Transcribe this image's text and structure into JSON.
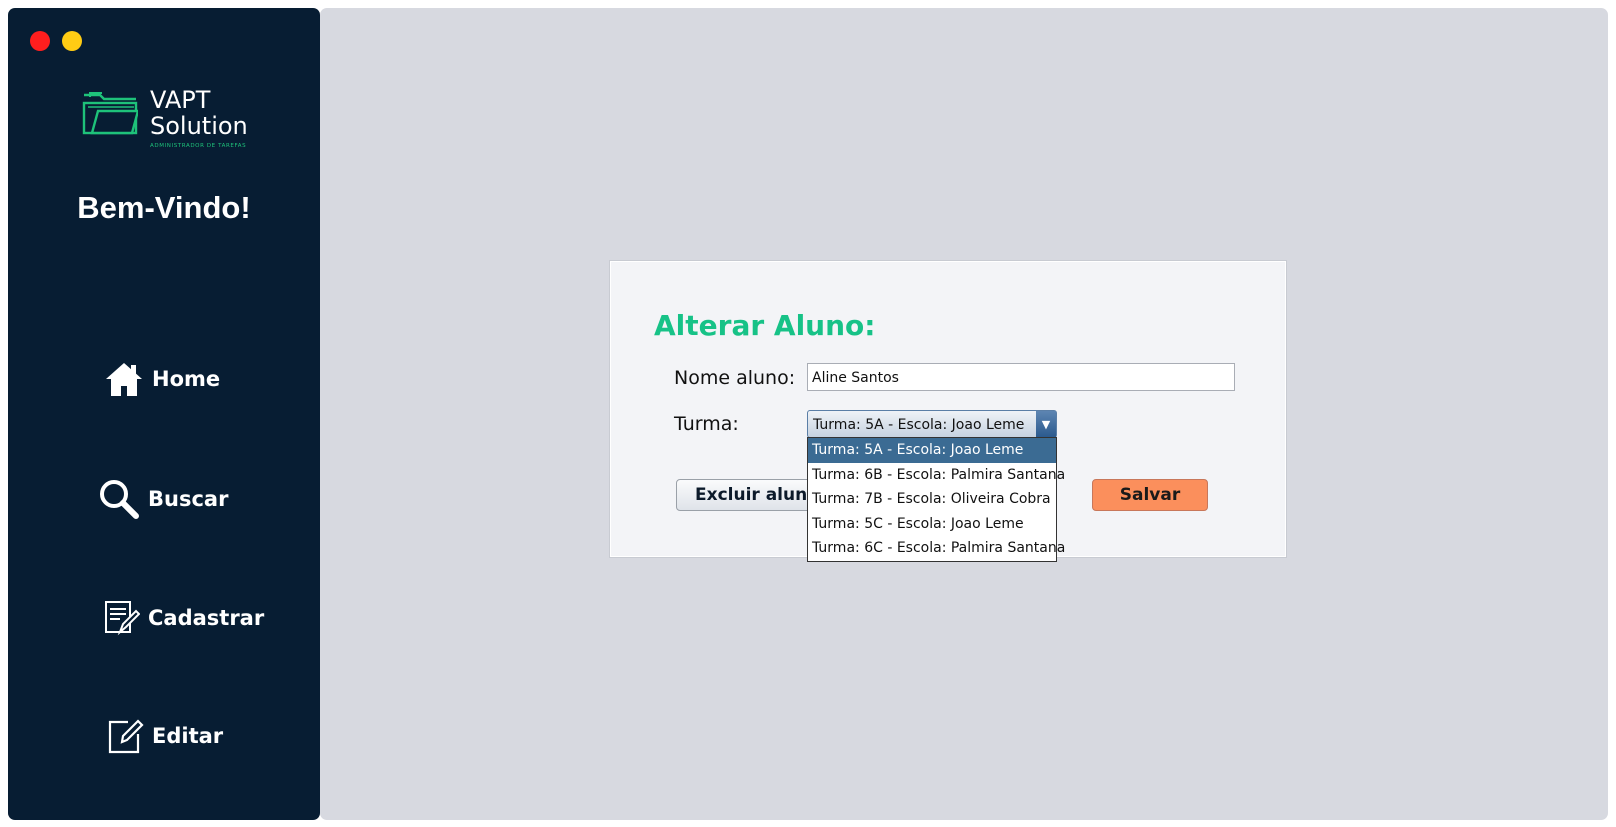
{
  "window": {
    "controls": [
      "close",
      "minimize"
    ],
    "colors": {
      "close": "#ff1e1e",
      "minimize": "#ffcc14"
    }
  },
  "sidebar": {
    "logo": {
      "line1": "VAPT",
      "line2": "Solution",
      "tagline": "ADMINISTRADOR DE TAREFAS"
    },
    "welcome": "Bem-Vindo!",
    "items": [
      {
        "label": "Home",
        "icon": "home-icon"
      },
      {
        "label": "Buscar",
        "icon": "search-icon"
      },
      {
        "label": "Cadastrar",
        "icon": "register-icon"
      },
      {
        "label": "Editar",
        "icon": "edit-icon"
      }
    ],
    "colors": {
      "background": "#071d33",
      "accent": "#1ec27a"
    }
  },
  "form": {
    "title": "Alterar Aluno:",
    "nome_label": "Nome aluno:",
    "nome_value": "Aline Santos",
    "turma_label": "Turma:",
    "turma_selected": "Turma: 5A - Escola: Joao Leme",
    "turma_options": [
      "Turma: 5A - Escola: Joao Leme",
      "Turma: 6B - Escola: Palmira Santana",
      "Turma: 7B - Escola: Oliveira Cobra",
      "Turma: 5C - Escola: Joao Leme",
      "Turma: 6C - Escola: Palmira Santana"
    ],
    "excluir_label": "Excluir aluno(",
    "salvar_label": "Salvar",
    "colors": {
      "title": "#17c287",
      "salvar": "#fb8f5c",
      "selected_option": "#3b6b93"
    }
  }
}
